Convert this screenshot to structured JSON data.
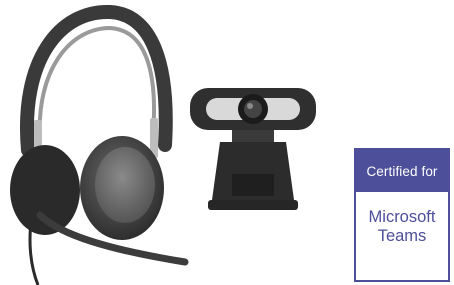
{
  "products": {
    "headset": {
      "icon": "headset-icon"
    },
    "webcam": {
      "icon": "webcam-icon"
    }
  },
  "badge": {
    "header": "Certified for",
    "line1": "Microsoft",
    "line2": "Teams",
    "color": "#4d4f9a"
  }
}
